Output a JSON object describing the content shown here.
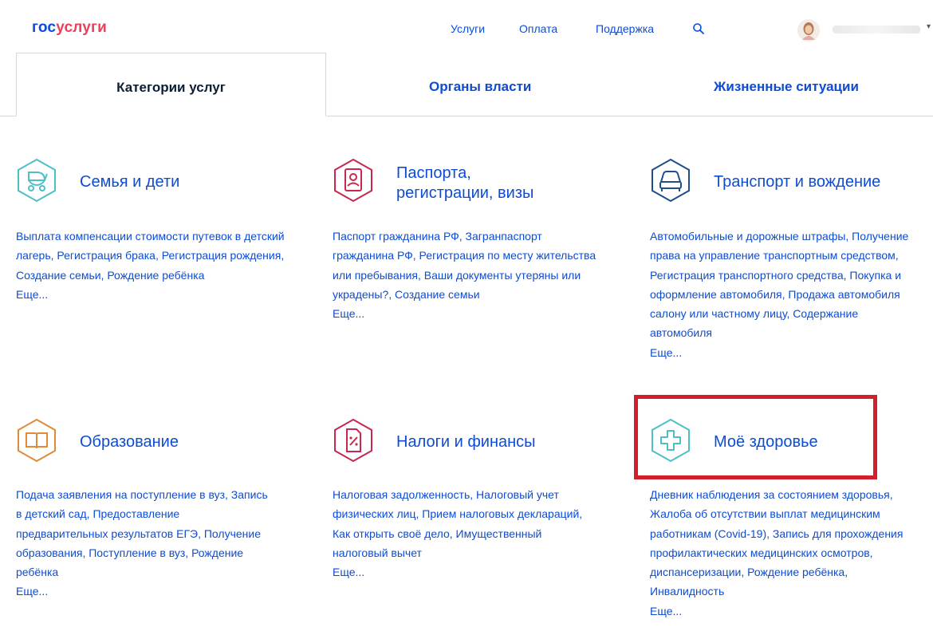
{
  "header": {
    "logo_part1": "гос",
    "logo_part2": "услуги",
    "nav": [
      "Услуги",
      "Оплата",
      "Поддержка"
    ],
    "icons": {
      "search": "search-icon",
      "avatar": "avatar-icon"
    }
  },
  "tabs": [
    {
      "label": "Категории услуг",
      "active": true
    },
    {
      "label": "Органы власти",
      "active": false
    },
    {
      "label": "Жизненные ситуации",
      "active": false
    }
  ],
  "colors": {
    "link": "#0d4cd3",
    "accent_red": "#ee3f58",
    "teal": "#4dc0c6",
    "crimson": "#c8284d",
    "navy": "#1f4e8c",
    "orange": "#e08a3a",
    "highlight": "#d1202b"
  },
  "categories": [
    {
      "title_line1": "Семья и дети",
      "title_line2": "",
      "icon": "baby-stroller-icon",
      "desc": "Выплата компенсации стоимости путевок в детский лагерь, Регистрация брака, Регистрация рождения, Создание семьи, Рождение ребёнка",
      "more": "Еще..."
    },
    {
      "title_line1": "Паспорта,",
      "title_line2": "регистрации, визы",
      "icon": "passport-icon",
      "desc": "Паспорт гражданина РФ, Загранпаспорт гражданина РФ, Регистрация по месту жительства или пребывания, Ваши документы утеряны или украдены?, Создание семьи",
      "more": "Еще..."
    },
    {
      "title_line1": "Транспорт и вождение",
      "title_line2": "",
      "icon": "car-icon",
      "desc": "Автомобильные и дорожные штрафы, Получение права на управление транспортным средством, Регистрация транспортного средства, Покупка и оформление автомобиля, Продажа автомобиля салону или частному лицу, Содержание автомобиля",
      "more": "Еще..."
    },
    {
      "title_line1": "Образование",
      "title_line2": "",
      "icon": "open-book-icon",
      "desc": "Подача заявления на поступление в вуз, Запись в детский сад, Предоставление предварительных результатов ЕГЭ, Получение образования, Поступление в вуз, Рождение ребёнка",
      "more": "Еще..."
    },
    {
      "title_line1": "Налоги и финансы",
      "title_line2": "",
      "icon": "tax-document-icon",
      "desc": "Налоговая задолженность, Налоговый учет физических лиц, Прием налоговых деклараций, Как открыть своё дело, Имущественный налоговый вычет",
      "more": "Еще..."
    },
    {
      "title_line1": "Моё здоровье",
      "title_line2": "",
      "icon": "medical-cross-icon",
      "desc": "Дневник наблюдения за состоянием здоровья, Жалоба об отсутствии выплат медицинским работникам (Covid-19), Запись для прохождения профилактических медицинских осмотров, диспансеризации, Рождение ребёнка, Инвалидность",
      "more": "Еще..."
    }
  ]
}
